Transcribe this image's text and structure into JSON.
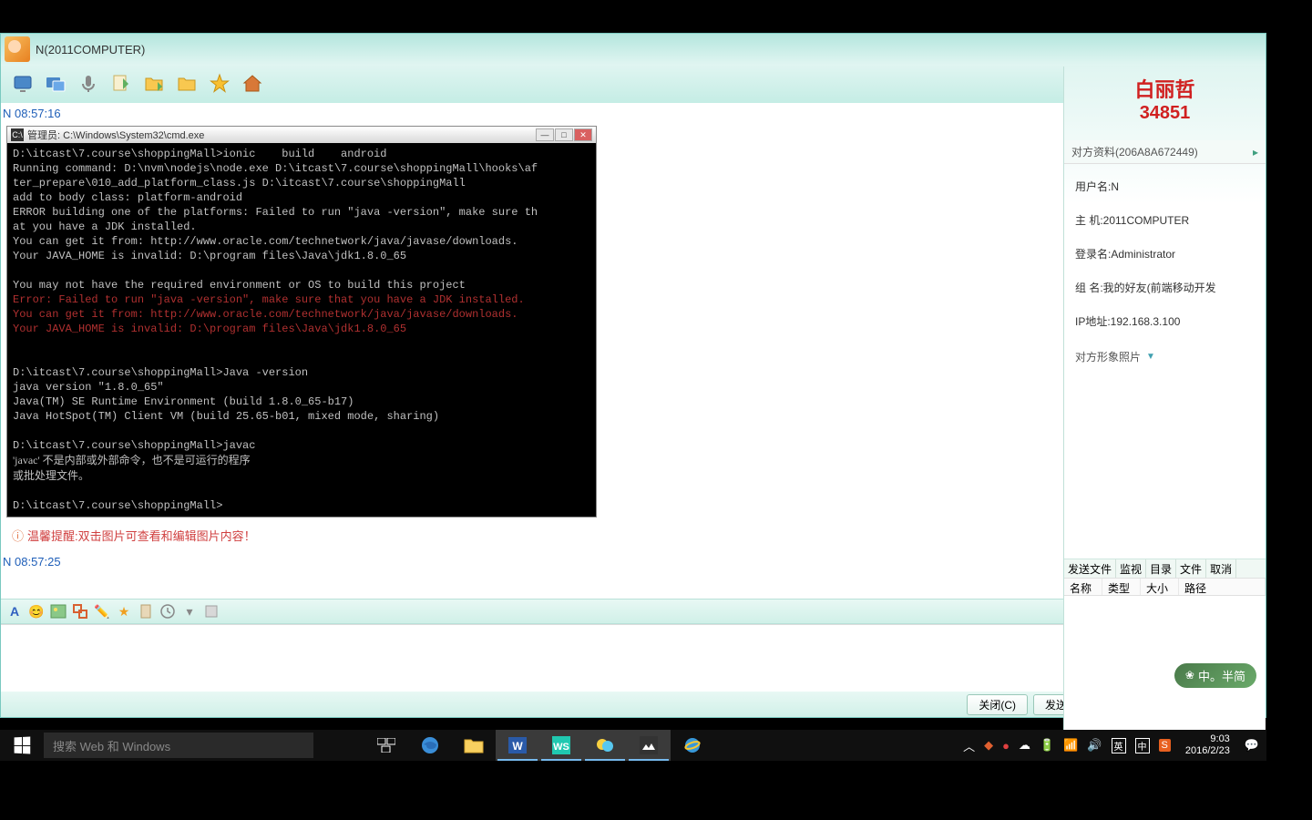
{
  "chat": {
    "title": "N(2011COMPUTER)",
    "msg_time1": "N 08:57:16",
    "msg_time2": "N 08:57:25",
    "tip": "温馨提醒:双击图片可查看和编辑图片内容！"
  },
  "cmd": {
    "title_prefix": "管理员:",
    "title_path": "C:\\Windows\\System32\\cmd.exe",
    "line1": "D:\\itcast\\7.course\\shoppingMall>ionic    build    android",
    "line2": "Running command: D:\\nvm\\nodejs\\node.exe D:\\itcast\\7.course\\shoppingMall\\hooks\\af",
    "line3": "ter_prepare\\010_add_platform_class.js D:\\itcast\\7.course\\shoppingMall",
    "line4": "add to body class: platform-android",
    "line5": "ERROR building one of the platforms: Failed to run \"java -version\", make sure th",
    "line6": "at you have a JDK installed.",
    "line7": "You can get it from: http://www.oracle.com/technetwork/java/javase/downloads.",
    "line8": "Your JAVA_HOME is invalid: D:\\program files\\Java\\jdk1.8.0_65",
    "line9": "",
    "line10": "You may not have the required environment or OS to build this project",
    "err1": "Error: Failed to run \"java -version\", make sure that you have a JDK installed.",
    "err2": "You can get it from: http://www.oracle.com/technetwork/java/javase/downloads.",
    "err3": "Your JAVA_HOME is invalid: D:\\program files\\Java\\jdk1.8.0_65",
    "line11": "",
    "line12": "",
    "line13": "D:\\itcast\\7.course\\shoppingMall>Java -version",
    "line14": "java version \"1.8.0_65\"",
    "line15": "Java(TM) SE Runtime Environment (build 1.8.0_65-b17)",
    "line16": "Java HotSpot(TM) Client VM (build 25.65-b01, mixed mode, sharing)",
    "line17": "",
    "line18": "D:\\itcast\\7.course\\shoppingMall>javac",
    "line19": "'javac' 不是内部或外部命令，也不是可运行的程序",
    "line20": "或批处理文件。",
    "line21": "",
    "line22": "D:\\itcast\\7.course\\shoppingMall>"
  },
  "sidebar": {
    "wm_name": "白丽哲",
    "wm_num": "34851",
    "header1": "对方资料(206A8A672449)",
    "user_label": "用户名:N",
    "host_label": "主 机:2011COMPUTER",
    "login_label": "登录名:Administrator",
    "group_label": "组 名:我的好友(前端移动开发",
    "ip_label": "IP地址:192.168.3.100",
    "photo_label": "对方形象照片",
    "ft_tabs": [
      "发送文件",
      "监视",
      "目录",
      "文件",
      "取消"
    ],
    "ft_headers": [
      "名称",
      "类型",
      "大小",
      "路径"
    ],
    "input_method": "中。半简"
  },
  "sendbar": {
    "close": "关闭(C)",
    "send": "发送(S)"
  },
  "taskbar": {
    "search_placeholder": "搜索 Web 和 Windows",
    "time": "9:03",
    "date": "2016/2/23"
  }
}
